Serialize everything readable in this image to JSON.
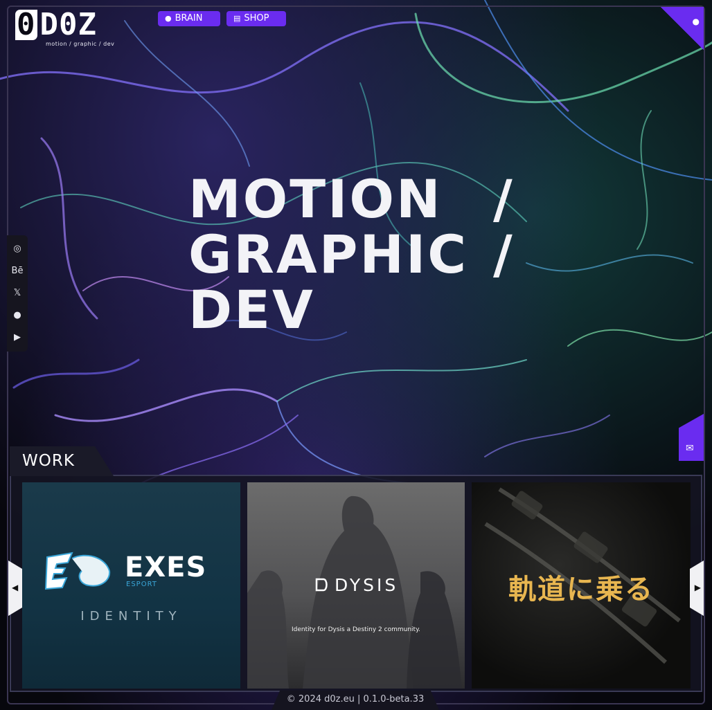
{
  "header": {
    "logo_text": "D0Z",
    "logo_initial": "0",
    "logo_tagline": "motion / graphic / dev",
    "nav": [
      {
        "label": "BRAIN",
        "icon": "brain-icon"
      },
      {
        "label": "SHOP",
        "icon": "basket-icon"
      }
    ],
    "corner_icon": "cookie-icon"
  },
  "hero": {
    "lines": [
      "MOTION",
      "GRAPHIC",
      "DEV"
    ],
    "separator": "/"
  },
  "social": [
    {
      "name": "instagram",
      "glyph": "◎"
    },
    {
      "name": "behance",
      "glyph": "Bē"
    },
    {
      "name": "x",
      "glyph": "𝕏"
    },
    {
      "name": "github",
      "glyph": "●"
    },
    {
      "name": "youtube",
      "glyph": "▶"
    }
  ],
  "contact_icon": "mail-icon",
  "work": {
    "heading": "WORK",
    "cards": [
      {
        "name": "EXES",
        "subtitle": "ESPORT",
        "tagline": "IDENTITY"
      },
      {
        "name": "DYSIS",
        "description": "Identity for Dysis a Destiny 2 community."
      },
      {
        "name": "軌道に乗る"
      }
    ]
  },
  "footer": {
    "text": "© 2024 d0z.eu | 0.1.0-beta.33"
  },
  "colors": {
    "accent": "#6a2cf0",
    "panel": "#16151f",
    "gold": "#e8b650",
    "exes_blue": "#3aa6d8"
  }
}
